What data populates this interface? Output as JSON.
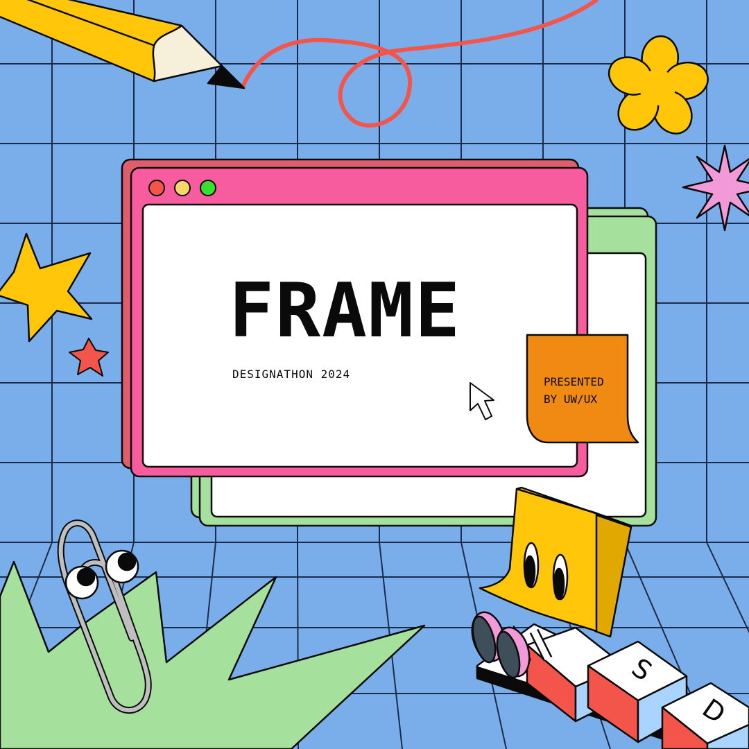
{
  "poster": {
    "title": "FRAME",
    "subtitle": "DESIGNATHON 2024",
    "note_line1": "PRESENTED",
    "note_line2": "BY UW/UX"
  },
  "keycaps": [
    "S",
    "D"
  ],
  "colors": {
    "background": "#7aaeea",
    "window_pink": "#f75c9e",
    "window_green": "#a6e09d",
    "sticky_orange": "#f08a12",
    "sticky_yellow": "#ffc60a",
    "accent_yellow": "#ffc60a",
    "accent_red": "#f4554b",
    "accent_pink": "#f29ad8"
  },
  "icons": [
    "pencil-icon",
    "flower-icon",
    "sparkle-icon",
    "star-icon",
    "paperclip-icon",
    "cursor-icon",
    "window-controls"
  ]
}
